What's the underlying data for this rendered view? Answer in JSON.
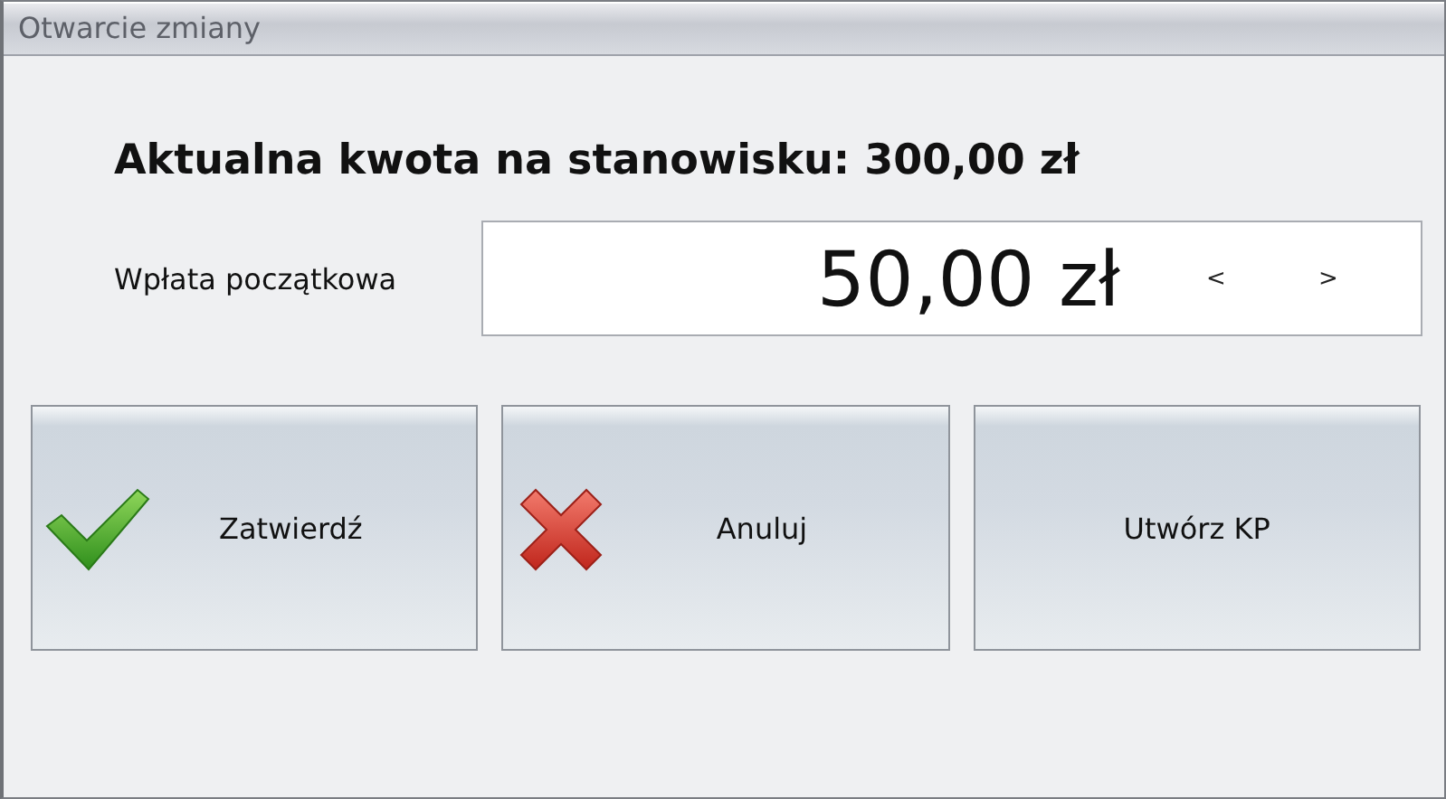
{
  "window": {
    "title": "Otwarcie zmiany"
  },
  "current_amount": {
    "label": "Aktualna kwota na stanowisku:",
    "value": "300,00 zł"
  },
  "deposit": {
    "label": "Wpłata początkowa",
    "value": "50,00 zł",
    "decrement": "<",
    "increment": ">"
  },
  "buttons": [
    {
      "label": "Zatwierdź",
      "kind": "confirm"
    },
    {
      "label": "Anuluj",
      "kind": "cancel"
    },
    {
      "label": "Utwórz KP",
      "kind": "action"
    }
  ]
}
